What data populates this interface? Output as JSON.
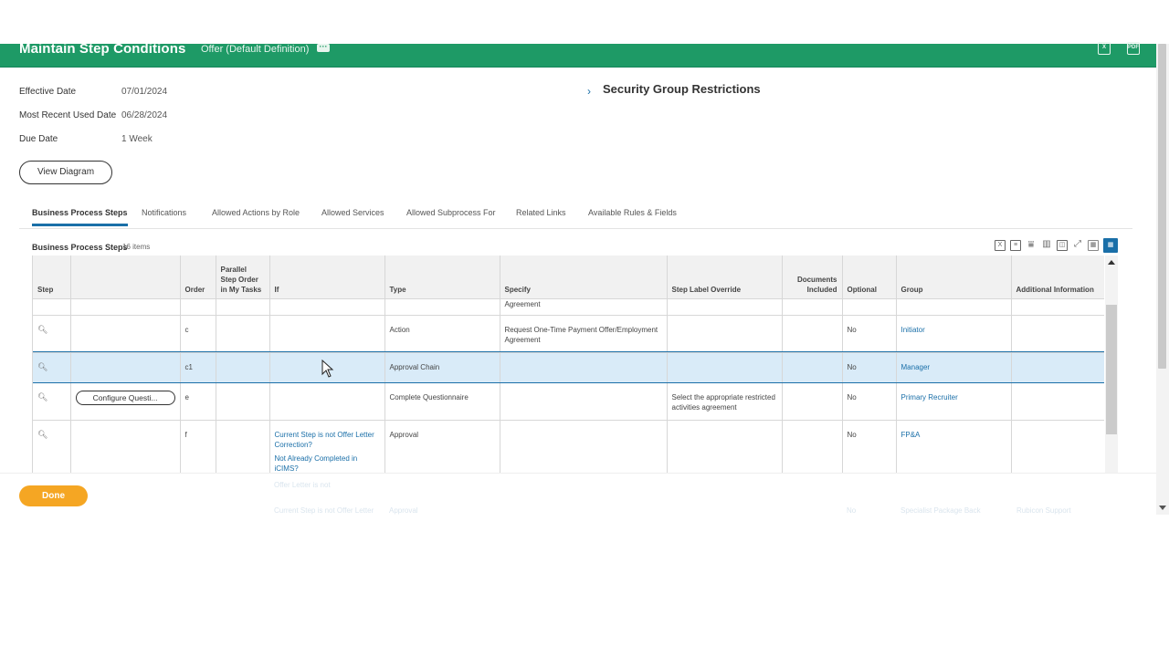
{
  "header": {
    "title": "Maintain Step Conditions",
    "subtitle": "Offer (Default Definition)",
    "more_icon": "ellipsis-icon",
    "export_excel_icon": "excel-export-icon",
    "export_pdf_icon": "pdf-export-icon",
    "pdf_label": "PDF",
    "brand_color": "#1e9a66"
  },
  "fields": [
    {
      "label": "Effective Date",
      "value": "07/01/2024"
    },
    {
      "label": "Most Recent Used Date",
      "value": "06/28/2024"
    },
    {
      "label": "Due Date",
      "value": "1 Week"
    }
  ],
  "view_diagram_label": "View Diagram",
  "security_group": {
    "label": "Security Group Restrictions"
  },
  "tabs": [
    {
      "label": "Business Process Steps",
      "active": true
    },
    {
      "label": "Notifications"
    },
    {
      "label": "Allowed Actions by Role"
    },
    {
      "label": "Allowed Services"
    },
    {
      "label": "Allowed Subprocess For"
    },
    {
      "label": "Related Links"
    },
    {
      "label": "Available Rules & Fields"
    }
  ],
  "grid": {
    "title": "Business Process Steps",
    "count": "16 items",
    "columns": [
      "Step",
      "",
      "Order",
      "Parallel Step Order in My Tasks",
      "If",
      "Type",
      "Specify",
      "Step Label Override",
      "Documents Included",
      "Optional",
      "Group",
      "Additional Information"
    ],
    "partial_row_specify": "Agreement",
    "rows": [
      {
        "order": "c",
        "if": [],
        "type": "Action",
        "specify": "Request One-Time Payment Offer/Employment Agreement",
        "label_override": "",
        "optional": "No",
        "group": "Initiator"
      },
      {
        "order": "c1",
        "if": [],
        "type": "Approval Chain",
        "specify": "",
        "label_override": "",
        "optional": "No",
        "group": "Manager"
      },
      {
        "order": "e",
        "button": "Configure Questi...",
        "if": [],
        "type": "Complete Questionnaire",
        "specify": "",
        "label_override": "Select the appropriate restricted activities agreement",
        "optional": "No",
        "group": "Primary Recruiter"
      },
      {
        "order": "f",
        "if": [
          "Current Step is not Offer Letter Correction?",
          "Not Already Completed in iCIMS?"
        ],
        "type": "Approval",
        "specify": "",
        "label_override": "",
        "optional": "No",
        "group": "FP&A"
      }
    ],
    "faded_row": {
      "if_partial": "Offer Letter is not",
      "if": "Current Step is not Offer Letter",
      "type": "Approval",
      "optional": "No",
      "group": "Specialist Package Back",
      "additional": "Rubicon Support"
    }
  },
  "footer": {
    "done_label": "Done",
    "done_color": "#f5a623"
  },
  "accent_color": "#1a6fa8"
}
